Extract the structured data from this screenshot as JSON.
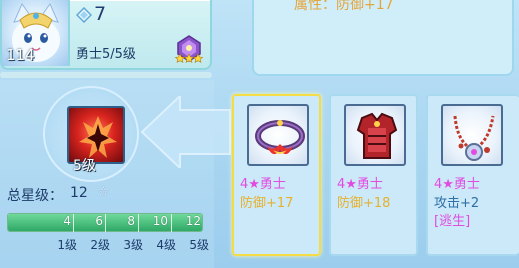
{
  "hero": {
    "level": "114",
    "gem_count": "7",
    "rank_label": "勇士5/5级",
    "rank_stars": 3,
    "icon": "hero-portrait"
  },
  "attribute_panel": {
    "text": "属性：防御+17"
  },
  "summary": {
    "tier_label": "5级",
    "total_star_label": "总星级：",
    "total_star_value": "12",
    "star_glyph": "☆",
    "progress": 1.0,
    "ticks": [
      "4",
      "6",
      "8",
      "10",
      "12"
    ],
    "levels": [
      "1级",
      "2级",
      "3级",
      "4级",
      "5级"
    ]
  },
  "equipment": [
    {
      "name": "4★勇士",
      "stat": "防御+17",
      "tag": "",
      "selected": true,
      "icon": "bracelet-icon"
    },
    {
      "name": "4★勇士",
      "stat": "防御+18",
      "tag": "",
      "selected": false,
      "icon": "armor-icon"
    },
    {
      "name": "4★勇士",
      "stat": "攻击+2",
      "tag": "[逃生]",
      "selected": false,
      "icon": "necklace-icon"
    }
  ],
  "colors": {
    "gold": "#e6b12e",
    "magenta": "#e24be0",
    "navy": "#1d3c69",
    "highlight": "#f4dc46"
  }
}
